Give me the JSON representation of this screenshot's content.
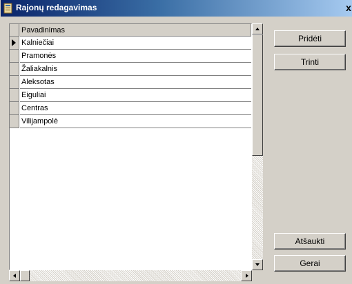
{
  "window": {
    "title": "Rajonų redagavimas",
    "close_glyph": "x",
    "icon": "app-window-icon"
  },
  "grid": {
    "column_header": "Pavadinimas",
    "current_row_index": 0,
    "rows": [
      "Kalniečiai",
      "Pramonės",
      "Žaliakalnis",
      "Aleksotas",
      "Eiguliai",
      "Centras",
      "Vilijampolė"
    ]
  },
  "buttons": {
    "add": "Pridėti",
    "delete": "Trinti",
    "cancel": "Atšaukti",
    "ok": "Gerai"
  },
  "colors": {
    "face": "#d4d0c8",
    "titlebar_start": "#0a246a",
    "titlebar_end": "#a6caf0"
  }
}
